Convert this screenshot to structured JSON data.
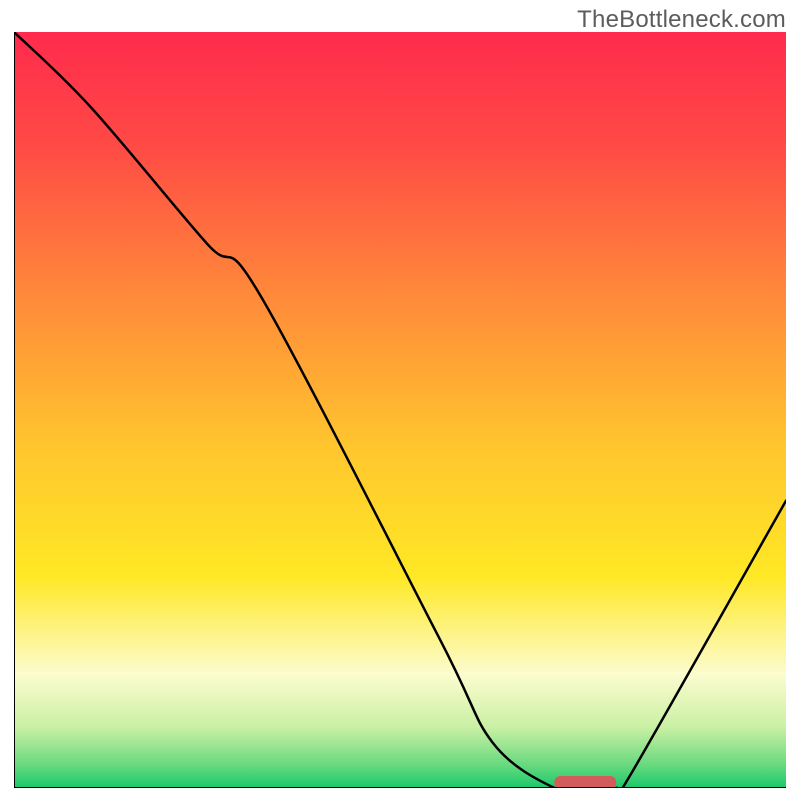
{
  "watermark": "TheBottleneck.com",
  "chart_data": {
    "type": "line",
    "title": "",
    "xlabel": "",
    "ylabel": "",
    "xlim": [
      0,
      100
    ],
    "ylim": [
      0,
      100
    ],
    "series": [
      {
        "name": "bottleneck-curve",
        "x": [
          0,
          10,
          25,
          32,
          55,
          62,
          70,
          74,
          78,
          80,
          100
        ],
        "y": [
          100,
          90,
          72,
          65,
          20,
          6,
          0,
          0,
          0,
          2,
          38
        ]
      }
    ],
    "marker": {
      "x_start": 70,
      "x_end": 78,
      "color": "#d25b5b"
    },
    "gradient_stops": [
      {
        "offset": 0.0,
        "color": "#ff2a4d"
      },
      {
        "offset": 0.15,
        "color": "#ff4a45"
      },
      {
        "offset": 0.35,
        "color": "#ff8a3a"
      },
      {
        "offset": 0.55,
        "color": "#ffc62e"
      },
      {
        "offset": 0.72,
        "color": "#ffe825"
      },
      {
        "offset": 0.85,
        "color": "#fcfccf"
      },
      {
        "offset": 0.92,
        "color": "#c9f0a4"
      },
      {
        "offset": 0.97,
        "color": "#67d97e"
      },
      {
        "offset": 1.0,
        "color": "#19c96b"
      }
    ],
    "axis_color": "#000000",
    "curve_color": "#000000"
  }
}
